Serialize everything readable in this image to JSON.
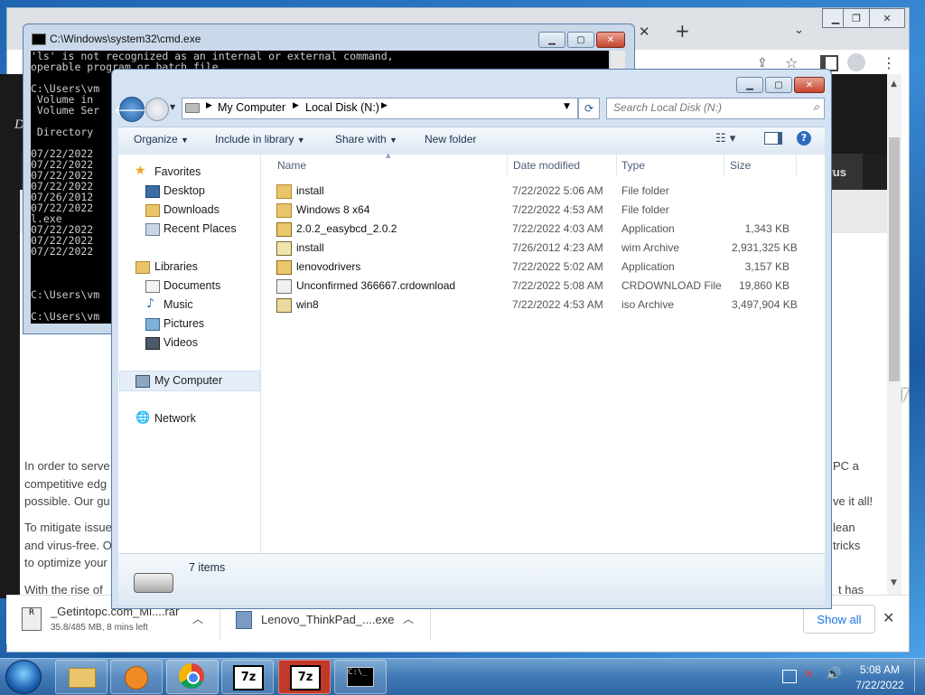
{
  "colors": {
    "accent": "#1a73e8",
    "cmd_bg": "#000000",
    "explorer_frame": "#d4e2f1",
    "taskbar": "#3f78b5"
  },
  "cmd": {
    "title": "C:\\Windows\\system32\\cmd.exe",
    "lines": [
      "'ls' is not recognized as an internal or external command,",
      "operable program or batch file.",
      "",
      "C:\\Users\\vm",
      " Volume in",
      " Volume Ser",
      "",
      " Directory",
      "",
      "07/22/2022",
      "07/22/2022",
      "07/22/2022",
      "07/22/2022",
      "07/26/2012",
      "07/22/2022",
      "l.exe",
      "07/22/2022",
      "07/22/2022",
      "07/22/2022",
      "",
      "",
      "",
      "C:\\Users\\vm",
      "",
      "C:\\Users\\vm"
    ]
  },
  "browser": {
    "nav_virus": "irus",
    "page_left_letter": "D",
    "para1": [
      "In order to serve",
      "competitive edg",
      "possible. Our gu"
    ],
    "para1_right": [
      "PC a",
      "",
      "ve it all!"
    ],
    "para2": [
      "To mitigate issue",
      "and virus-free. O",
      "to optimize your"
    ],
    "para2_right": [
      "lean",
      "tricks",
      ""
    ],
    "para3": "With the rise of",
    "para3_right": "t has"
  },
  "downloads": {
    "items": [
      {
        "name": "_Getintopc.com_Mi....rar",
        "sub": "35.8/485 MB, 8 mins left"
      },
      {
        "name": "Lenovo_ThinkPad_....exe",
        "sub": ""
      }
    ],
    "show_all": "Show all"
  },
  "explorer": {
    "breadcrumb": [
      "My Computer",
      "Local Disk (N:)"
    ],
    "search_placeholder": "Search Local Disk (N:)",
    "toolbar": {
      "organize": "Organize",
      "include": "Include in library",
      "share": "Share with",
      "newfolder": "New folder"
    },
    "nav": {
      "favorites": "Favorites",
      "desktop": "Desktop",
      "downloads": "Downloads",
      "recent": "Recent Places",
      "libraries": "Libraries",
      "documents": "Documents",
      "music": "Music",
      "pictures": "Pictures",
      "videos": "Videos",
      "mycomputer": "My Computer",
      "network": "Network"
    },
    "columns": {
      "name": "Name",
      "date": "Date modified",
      "type": "Type",
      "size": "Size"
    },
    "files": [
      {
        "name": "install",
        "date": "7/22/2022 5:06 AM",
        "type": "File folder",
        "size": "",
        "icon": "folder-icon"
      },
      {
        "name": "Windows 8 x64",
        "date": "7/22/2022 4:53 AM",
        "type": "File folder",
        "size": "",
        "icon": "folder-icon"
      },
      {
        "name": "2.0.2_easybcd_2.0.2",
        "date": "7/22/2022 4:03 AM",
        "type": "Application",
        "size": "1,343 KB",
        "icon": "application-icon"
      },
      {
        "name": "install",
        "date": "7/26/2012 4:23 AM",
        "type": "wim Archive",
        "size": "2,931,325 KB",
        "icon": "archive-icon"
      },
      {
        "name": "lenovodrivers",
        "date": "7/22/2022 5:02 AM",
        "type": "Application",
        "size": "3,157 KB",
        "icon": "application-icon"
      },
      {
        "name": "Unconfirmed 366667.crdownload",
        "date": "7/22/2022 5:08 AM",
        "type": "CRDOWNLOAD File",
        "size": "19,860 KB",
        "icon": "file-icon"
      },
      {
        "name": "win8",
        "date": "7/22/2022 4:53 AM",
        "type": "iso Archive",
        "size": "3,497,904 KB",
        "icon": "iso-icon"
      }
    ],
    "item_count": "7 items"
  },
  "taskbar": {
    "time": "5:08 AM",
    "date": "7/22/2022",
    "btn_7z": "7z"
  }
}
